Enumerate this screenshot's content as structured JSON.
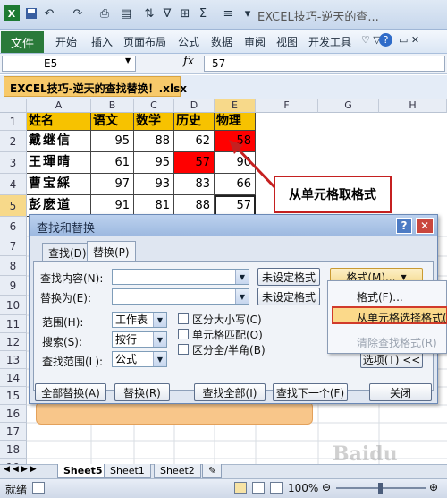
{
  "app": {
    "title": "EXCEL技巧-逆天的查..."
  },
  "ribbon": {
    "file": "文件",
    "tabs": [
      "开始",
      "插入",
      "页面布局",
      "公式",
      "数据",
      "审阅",
      "视图",
      "开发工具"
    ]
  },
  "formula_bar": {
    "name_box": "E5",
    "fx": "fx",
    "value": "57"
  },
  "document_tab": "EXCEL技巧-逆天的查找替换！.xlsx",
  "grid": {
    "columns": [
      "A",
      "B",
      "C",
      "D",
      "E",
      "F",
      "G",
      "H"
    ],
    "rows": [
      "1",
      "2",
      "3",
      "4",
      "5",
      "6",
      "7",
      "8",
      "9",
      "10",
      "11",
      "12",
      "13",
      "14",
      "15",
      "16",
      "17",
      "18",
      "19"
    ],
    "headers": [
      "姓名",
      "语文",
      "数学",
      "历史",
      "物理"
    ],
    "data": [
      [
        "戴继信",
        "95",
        "88",
        "62",
        "58"
      ],
      [
        "王琿晴",
        "61",
        "95",
        "57",
        "90"
      ],
      [
        "曹宝綵",
        "97",
        "93",
        "83",
        "66"
      ],
      [
        "彭麽道",
        "91",
        "81",
        "88",
        "57"
      ]
    ]
  },
  "callout": "从单元格取格式",
  "dialog": {
    "title": "查找和替换",
    "tabs": {
      "find": "查找(D)",
      "replace": "替换(P)"
    },
    "find_label": "查找内容(N):",
    "replace_label": "替换为(E):",
    "format_status": "未设定格式",
    "format_button": "格式(M)...",
    "scope_label": "范围(H):",
    "scope_value": "工作表",
    "search_label": "搜索(S):",
    "search_value": "按行",
    "lookin_label": "查找范围(L):",
    "lookin_value": "公式",
    "match_case": "区分大小写(C)",
    "match_cell": "单元格匹配(O)",
    "match_byte": "区分全/半角(B)",
    "options_button": "选项(T) <<",
    "replace_all": "全部替换(A)",
    "replace": "替换(R)",
    "find_all": "查找全部(I)",
    "find_next": "查找下一个(F)",
    "close": "关闭"
  },
  "format_menu": [
    "格式(F)...",
    "从单元格选择格式(C)...",
    "清除查找格式(R)"
  ],
  "sheet_tabs": [
    "Sheet5",
    "Sheet1",
    "Sheet2"
  ],
  "status": {
    "ready": "就绪",
    "zoom": "100%"
  },
  "watermark": "Baidu"
}
